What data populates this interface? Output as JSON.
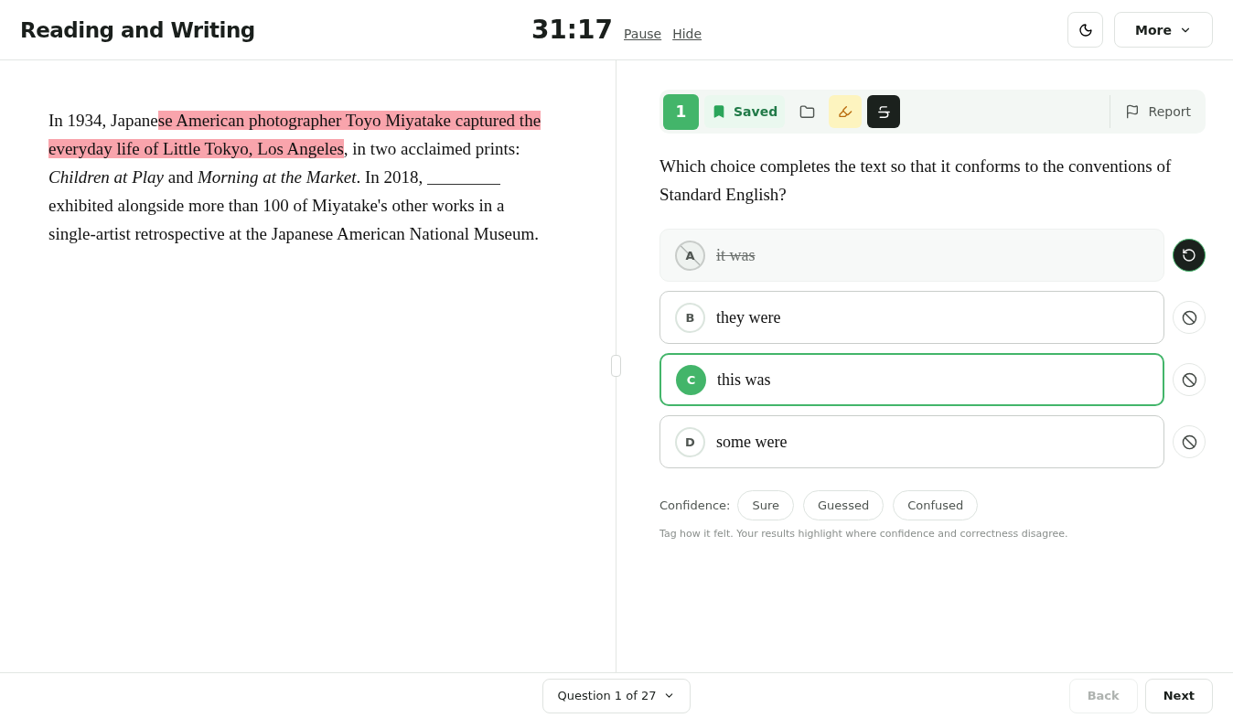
{
  "header": {
    "title": "Reading and Writing",
    "timer": "31:17",
    "pause": "Pause",
    "hide": "Hide",
    "dark_mode": false,
    "more": "More"
  },
  "passage": [
    {
      "kind": "text",
      "text": "In 1934, Japane"
    },
    {
      "kind": "highlight",
      "text": "se American photographer Toyo Miyatake captured the everyday life of Little Tokyo, Los Angeles"
    },
    {
      "kind": "text",
      "text": ", in two acclaimed prints: "
    },
    {
      "kind": "italic",
      "text": "Children at Play"
    },
    {
      "kind": "text",
      "text": " and "
    },
    {
      "kind": "italic",
      "text": "Morning at the Market"
    },
    {
      "kind": "text",
      "text": ". In 2018, "
    },
    {
      "kind": "blank"
    },
    {
      "kind": "text",
      "text": " exhibited alongside more than 100 of Miyatake's other works in a single-artist retrospective at the Japanese American National Museum."
    }
  ],
  "toolbar": {
    "number": "1",
    "saved": true,
    "saved_label": "Saved",
    "highlighter_on": true,
    "strikethrough_on": true,
    "report": "Report"
  },
  "question": "Which choice completes the text so that it conforms to the conventions of Standard English?",
  "choices": [
    {
      "letter": "A",
      "text": "it was",
      "selected": false,
      "crossed_out": true
    },
    {
      "letter": "B",
      "text": "they were",
      "selected": false,
      "crossed_out": false
    },
    {
      "letter": "C",
      "text": "this was",
      "selected": true,
      "crossed_out": false
    },
    {
      "letter": "D",
      "text": "some were",
      "selected": false,
      "crossed_out": false
    }
  ],
  "confidence": {
    "label": "Confidence:",
    "options": [
      {
        "label": "Sure",
        "selected": false
      },
      {
        "label": "Guessed",
        "selected": false
      },
      {
        "label": "Confused",
        "selected": false
      }
    ],
    "hint": "Tag how it felt. Your results highlight where confidence and correctness disagree."
  },
  "footer": {
    "question_nav": "Question 1 of 27",
    "back": "Back",
    "back_disabled": true,
    "next": "Next"
  }
}
